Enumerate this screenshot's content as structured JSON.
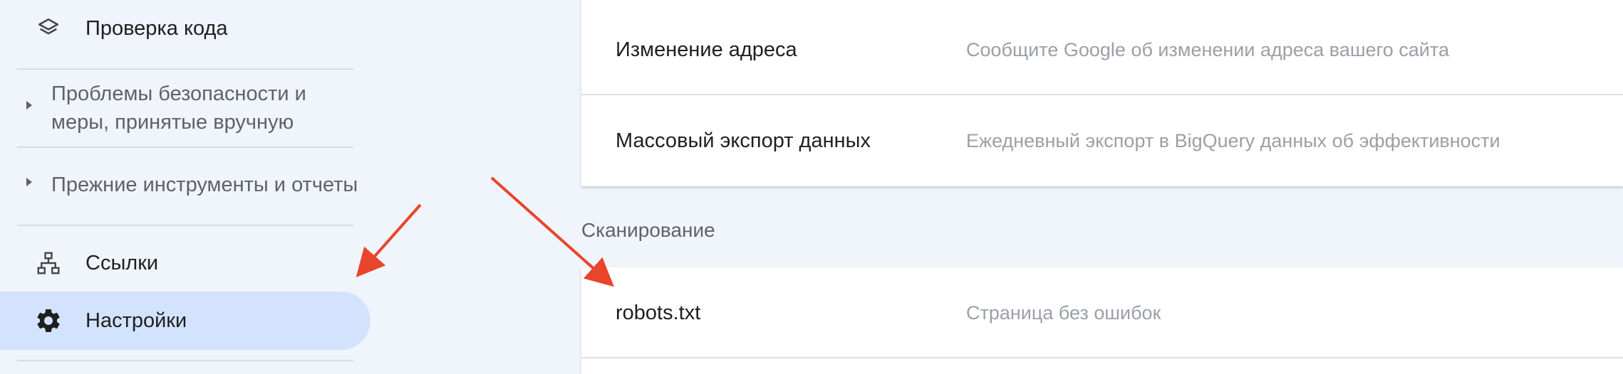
{
  "sidebar": {
    "items": [
      {
        "label": "Проверка кода",
        "icon": "layers-icon"
      },
      {
        "label": "Проблемы безопасности и меры, принятые вручную",
        "line1": "Проблемы безопасности и",
        "line2": "меры, принятые вручную",
        "type": "group"
      },
      {
        "label": "Прежние инструменты и отчеты",
        "type": "group"
      },
      {
        "label": "Ссылки",
        "icon": "sitemap-icon"
      },
      {
        "label": "Настройки",
        "icon": "gear-icon",
        "active": true
      }
    ]
  },
  "main": {
    "general_rows": [
      {
        "title": "Изменение адреса",
        "description": "Сообщите Google об изменении адреса вашего сайта"
      },
      {
        "title": "Массовый экспорт данных",
        "description": "Ежедневный экспорт в BigQuery данных об эффективности"
      }
    ],
    "crawl_section": {
      "title": "Сканирование",
      "rows": [
        {
          "title": "robots.txt",
          "description": "Страница без ошибок"
        }
      ]
    }
  },
  "colors": {
    "background": "#f0f4fb",
    "active_item": "#d3e3fd",
    "annotation_arrow": "#e8452c"
  }
}
